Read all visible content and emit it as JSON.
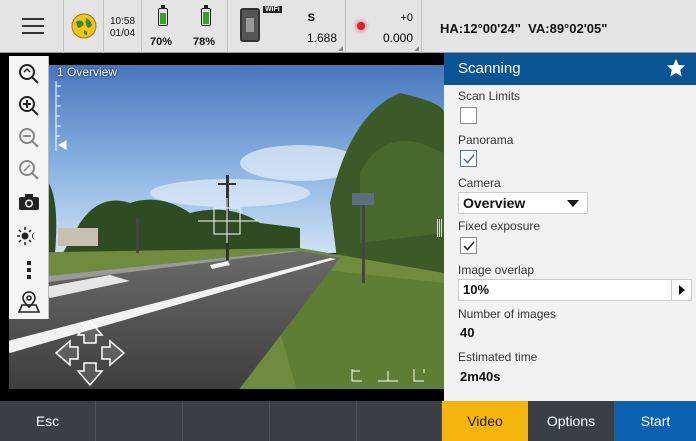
{
  "status_bar": {
    "menu_icon": "hamburger-menu-icon",
    "globe_icon": "globe-icon",
    "time": "10:58",
    "date": "01/04",
    "battery_1_percent": "70%",
    "battery_1_level": 0.7,
    "battery_2_percent": "78%",
    "battery_2_level": 0.78,
    "instrument_icon": "total-station-icon",
    "wifi_label": "WiFi",
    "instrument_mode": "S",
    "instrument_value": "1.688",
    "target_icon": "red-dot-target-icon",
    "target_offset": "+0",
    "target_value": "0.000",
    "angles": "HA:12°00'24\"  VA:89°02'05\""
  },
  "camera": {
    "view_label": "1 Overview"
  },
  "toolbar": {
    "icons": [
      "zoom-to-fit-icon",
      "zoom-in-icon",
      "zoom-out-icon",
      "zoom-reset-icon",
      "camera-icon",
      "brightness-icon",
      "more-icon",
      "map-pin-icon"
    ]
  },
  "panel": {
    "title": "Scanning",
    "star_icon": "favorite-star-icon",
    "scan_limits_label": "Scan Limits",
    "scan_limits_checked": false,
    "panorama_label": "Panorama",
    "panorama_checked": true,
    "camera_label": "Camera",
    "camera_value": "Overview",
    "fixed_exposure_label": "Fixed exposure",
    "fixed_exposure_checked": true,
    "image_overlap_label": "Image overlap",
    "image_overlap_value": "10%",
    "number_of_images_label": "Number of images",
    "number_of_images_value": "40",
    "estimated_time_label": "Estimated time",
    "estimated_time_value": "2m40s"
  },
  "bottom_bar": {
    "esc_label": "Esc",
    "video_label": "Video",
    "options_label": "Options",
    "start_label": "Start"
  },
  "colors": {
    "header_blue": "#0a5494",
    "start_blue": "#0a62b0",
    "video_yellow": "#f5b50e",
    "battery_green": "#35a324"
  }
}
